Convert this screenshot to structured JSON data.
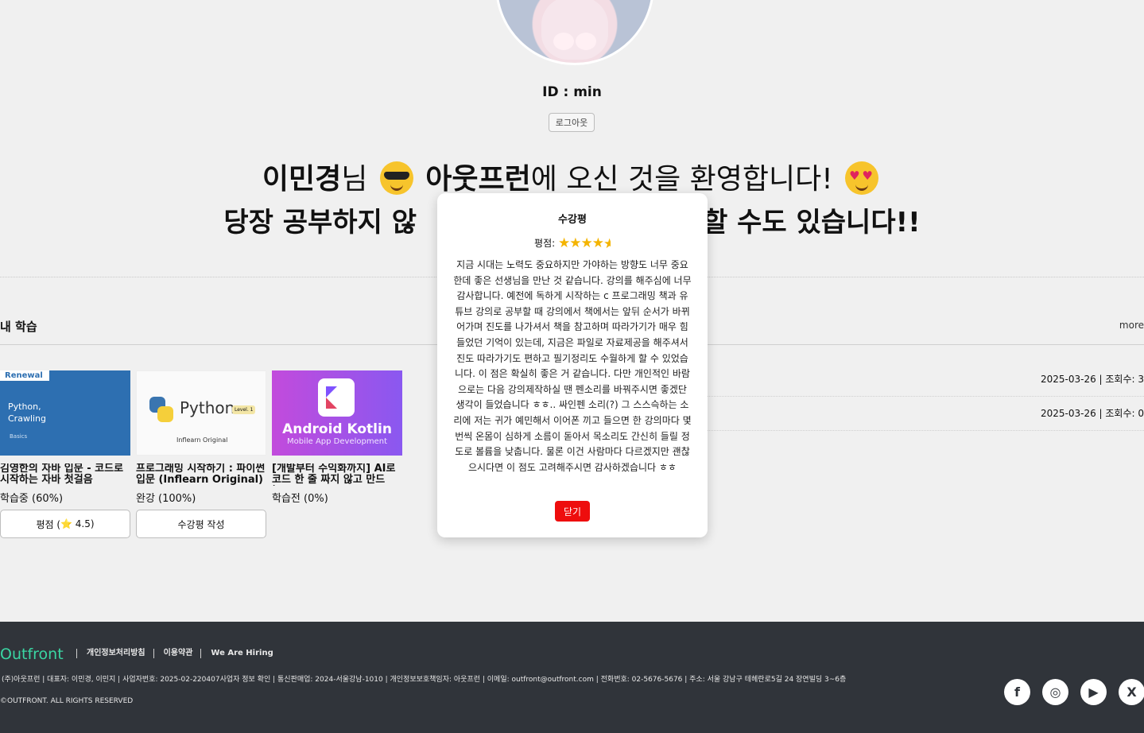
{
  "profile": {
    "user_id": "ID : min",
    "logout_label": "로그아웃"
  },
  "welcome": {
    "name": "이민경",
    "honorific": "님",
    "brand": "아웃프런",
    "suffix": "에 오신 것을 환영합니다!",
    "line2_left": "당장 공부하지 않",
    "line2_right": "할 수도 있습니다!!"
  },
  "my_learning": {
    "title": "내 학습",
    "more_label": "more"
  },
  "notices": [
    {
      "meta": "2025-03-26 | 조회수: 3"
    },
    {
      "meta": "2025-03-26 | 조회수: 0"
    }
  ],
  "courses": [
    {
      "badge": "Renewal",
      "thumb_title": "Python,\nCrawling",
      "thumb_sub": "Basics",
      "title": "김영한의 자바 입문 - 코드로 시작하는 자바 첫걸음",
      "status": "학습중 (60%)",
      "button_prefix": "평점 (",
      "button_star": "⭐",
      "button_value": "4.5)"
    },
    {
      "thumb_title": "Python",
      "thumb_level": "Level. 1",
      "thumb_sub": "Inflearn Original",
      "title": "프로그래밍 시작하기 : 파이썬 입문 (Inflearn Original)",
      "status": "완강 (100%)",
      "button_label": "수강평 작성"
    },
    {
      "thumb_title": "Android Kotlin",
      "thumb_sub": "Mobile App Development",
      "title": "[개발부터 수익화까지] AI로 코드 한 줄 짜지 않고 만드는...",
      "status": "학습전 (0%)"
    }
  ],
  "review_modal": {
    "title": "수강평",
    "rating_label": "평점:",
    "rating_value": 4.5,
    "text": "지금 시대는 노력도 중요하지만 가야하는 방향도 너무 중요한데 좋은 선생님을 만난 것 같습니다. 강의를 해주심에 너무 감사합니다. 예전에 독하게 시작하는 c 프로그래밍 책과 유튜브 강의로 공부할 때 강의에서 책에서는 앞뒤 순서가 바뀌어가며 진도를 나가셔서 책을 참고하며 따라가기가 매우 힘들었던 기억이 있는데, 지금은 파일로 자료제공을 해주셔서 진도 따라가기도 편하고 필기정리도 수월하게 할 수 있었습니다. 이 점은 확실히 좋은 거 같습니다. 다만 개인적인 바람으로는 다음 강의제작하실 땐 펜소리를 바꿔주시면 좋겠단 생각이 들었습니다 ㅎㅎ.. 싸인펜 소리(?) 그 스스슥하는 소리에 저는 귀가 예민해서 이어폰 끼고 들으면 한 강의마다 몇 번씩 온몸이 심하게 소름이 돋아서 목소리도 간신히 들릴 정도로 볼륨을 낮춥니다. 물론 이건 사람마다 다르겠지만 괜찮으시다면 이 점도 고려해주시면 감사하겠습니다 ㅎㅎ",
    "close_label": "닫기"
  },
  "footer": {
    "logo": "Outfront",
    "links": [
      "개인정보처리방침",
      "이용약관",
      "We Are Hiring"
    ],
    "info": "(주)아웃프런 |  대표자: 이민경, 이민지 |  사업자번호: 2025-02-220407사업자 정보 확인 | 통신판매업: 2024-서울강남-1010 |  개인정보보호책임자: 아웃프런 |  이메일: outfront@outfront.com | 전화번호: 02-5676-5676 |  주소: 서울 강남구 테헤란로5길 24 장연빌딩 3~6층",
    "copyright": "©OUTFRONT. ALL RIGHTS RESERVED",
    "social": [
      {
        "icon": "facebook-icon",
        "glyph": "f"
      },
      {
        "icon": "instagram-icon",
        "glyph": "◎"
      },
      {
        "icon": "youtube-icon",
        "glyph": "▶"
      },
      {
        "icon": "x-icon",
        "glyph": "X"
      }
    ]
  },
  "colors": {
    "accent_red": "#ee0d0d",
    "footer_bg": "#30343a",
    "brand_green": "#3ad6a3",
    "star": "#f4b400"
  }
}
